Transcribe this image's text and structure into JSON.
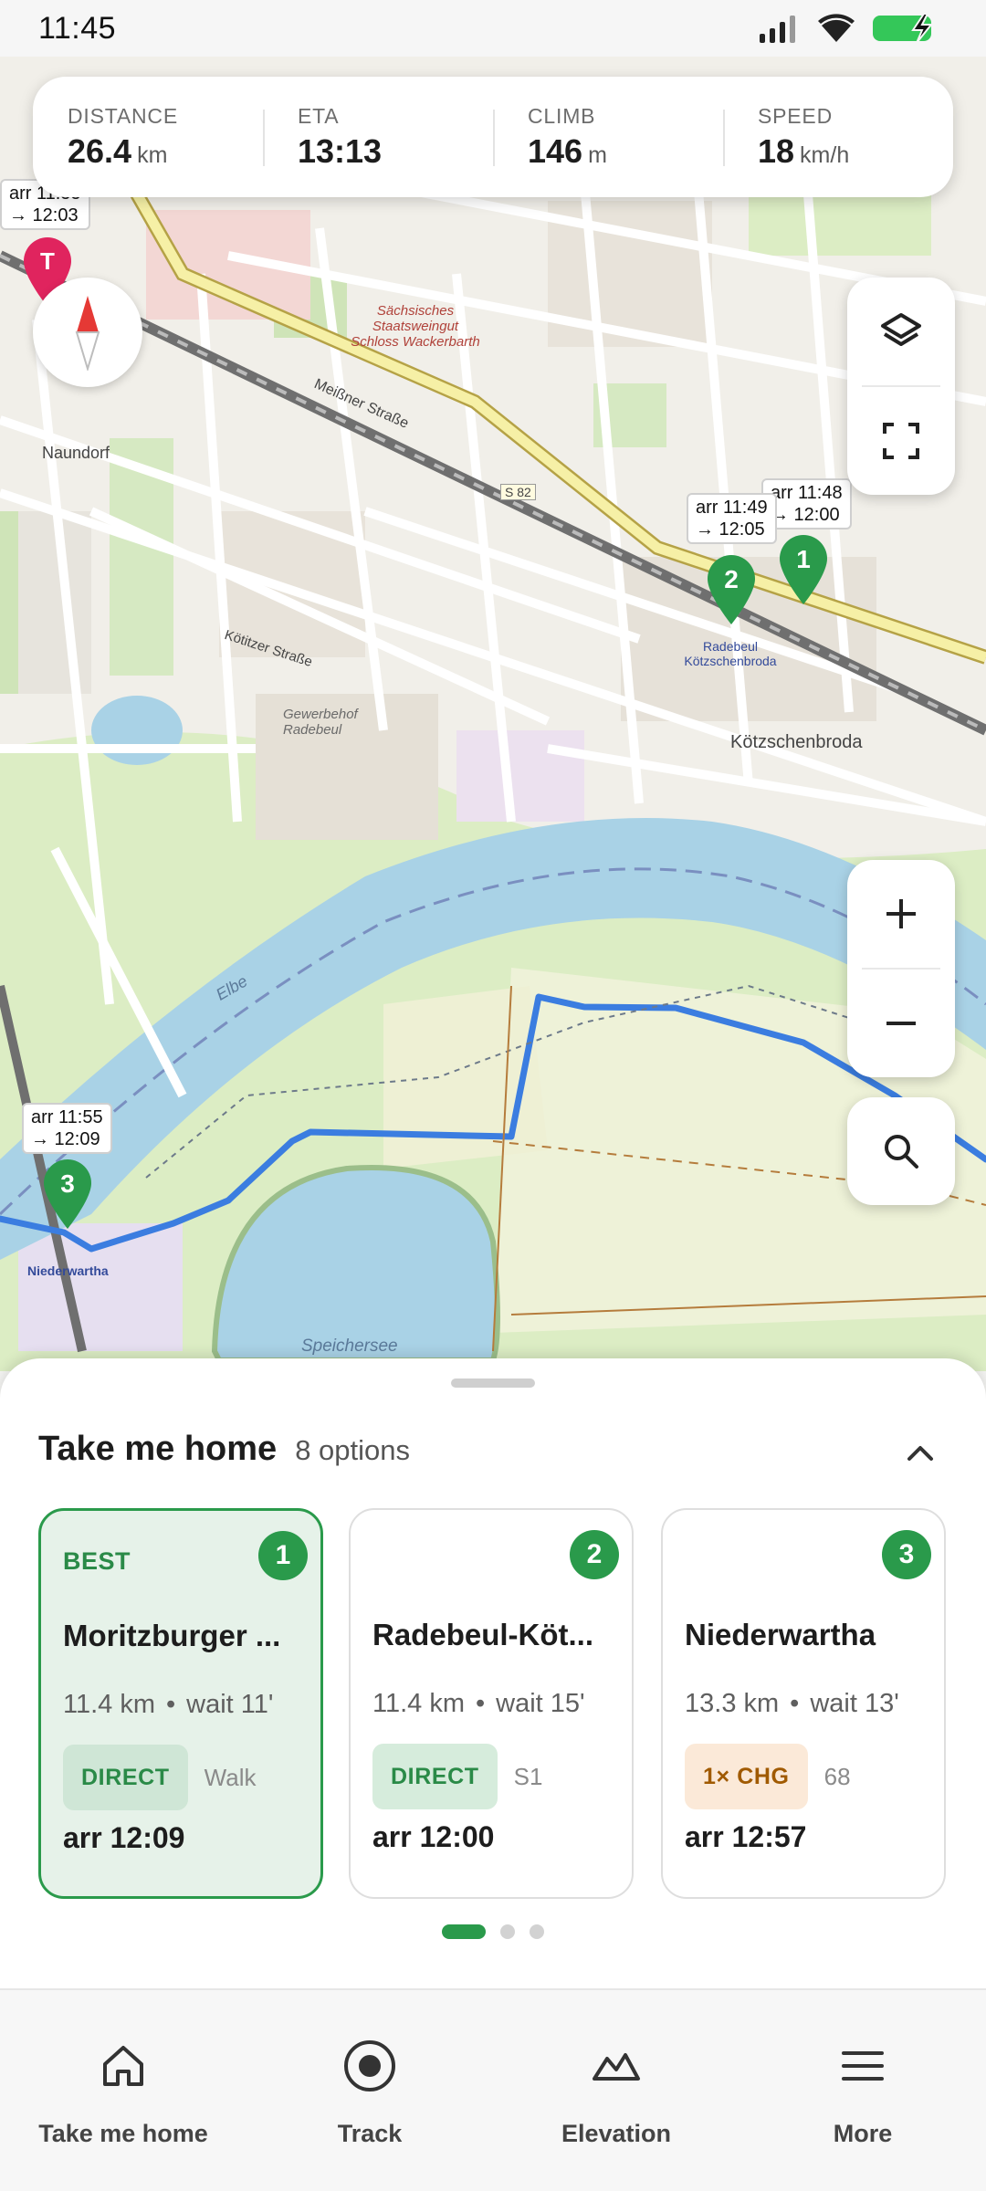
{
  "status_bar": {
    "time": "11:45"
  },
  "stats": [
    {
      "label": "DISTANCE",
      "value": "26.4",
      "unit": "km"
    },
    {
      "label": "ETA",
      "value": "13:13",
      "unit": ""
    },
    {
      "label": "CLIMB",
      "value": "146",
      "unit": "m"
    },
    {
      "label": "SPEED",
      "value": "18",
      "unit": "km/h"
    }
  ],
  "map": {
    "home_pin_label": "T",
    "stops": [
      {
        "number": "1",
        "arr": "arr 11:48",
        "dep": "→ 12:00"
      },
      {
        "number": "2",
        "arr": "arr 11:49",
        "dep": "→ 12:05"
      },
      {
        "number": "3",
        "arr": "arr 11:55",
        "dep": "→ 12:09"
      }
    ],
    "home_bubble": {
      "arr": "arr 11:55",
      "dep": "→ 12:03"
    },
    "place_labels": {
      "naundorf": "Naundorf",
      "radebeul_station": "Radebeul Kötzschenbroda",
      "koetzschenbroda": "Kötzschenbroda",
      "niederwartha": "Niederwartha",
      "speichersee": "Speichersee",
      "elbe": "Elbe",
      "gewerbehof": "Gewerbehof Radebeul",
      "schloss": "Sächsisches Staatsweingut Schloss Wackerbarth",
      "meissner": "Meißner Straße",
      "koetitzer": "Kötitzer Straße",
      "s82": "S 82"
    },
    "route_color": "#3b7de0",
    "accent_green": "#2a9a4b",
    "home_pin_color": "#e0245e"
  },
  "sheet": {
    "title": "Take me home",
    "count": "8 options",
    "cards": [
      {
        "tag": "BEST",
        "number": "1",
        "name": "Moritzburger ...",
        "distance": "11.4 km",
        "wait": "wait 11'",
        "chip": "DIRECT",
        "chip_sub": "Walk",
        "arr": "arr 12:09"
      },
      {
        "tag": "",
        "number": "2",
        "name": "Radebeul-Köt...",
        "distance": "11.4 km",
        "wait": "wait 15'",
        "chip": "DIRECT",
        "chip_sub": "S1",
        "arr": "arr 12:00"
      },
      {
        "tag": "",
        "number": "3",
        "name": "Niederwartha",
        "distance": "13.3 km",
        "wait": "wait 13'",
        "chip": "1× CHG",
        "chip_sub": "68",
        "arr": "arr 12:57"
      }
    ],
    "dot_separator": "•"
  },
  "nav": [
    {
      "label": "Take me home",
      "icon": "home-icon"
    },
    {
      "label": "Track",
      "icon": "record-icon"
    },
    {
      "label": "Elevation",
      "icon": "mountain-icon"
    },
    {
      "label": "More",
      "icon": "menu-icon"
    }
  ]
}
